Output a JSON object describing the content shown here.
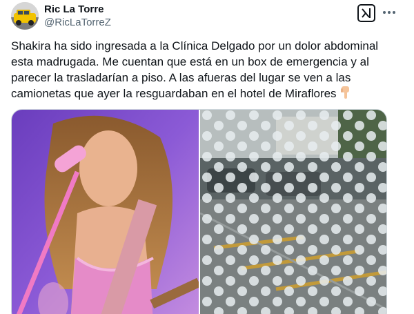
{
  "author": {
    "display_name": "Ric La Torre",
    "handle": "@RicLaTorreZ"
  },
  "tweet": {
    "text": "Shakira ha sido ingresada a la Clínica Delgado por un dolor abdominal esta madrugada. Me cuentan que está en un box de emergencia y al parecer la trasladarían a piso. A las afueras del lugar se ven a las camionetas que ayer la resguardaban en el hotel de Miraflores",
    "emoji": "pointing-down-hand"
  },
  "icons": {
    "grok": "grok-icon",
    "more": "more-icon"
  },
  "media": [
    {
      "alt": "singer-performing-photo"
    },
    {
      "alt": "street-through-dotted-glass-photo"
    }
  ]
}
